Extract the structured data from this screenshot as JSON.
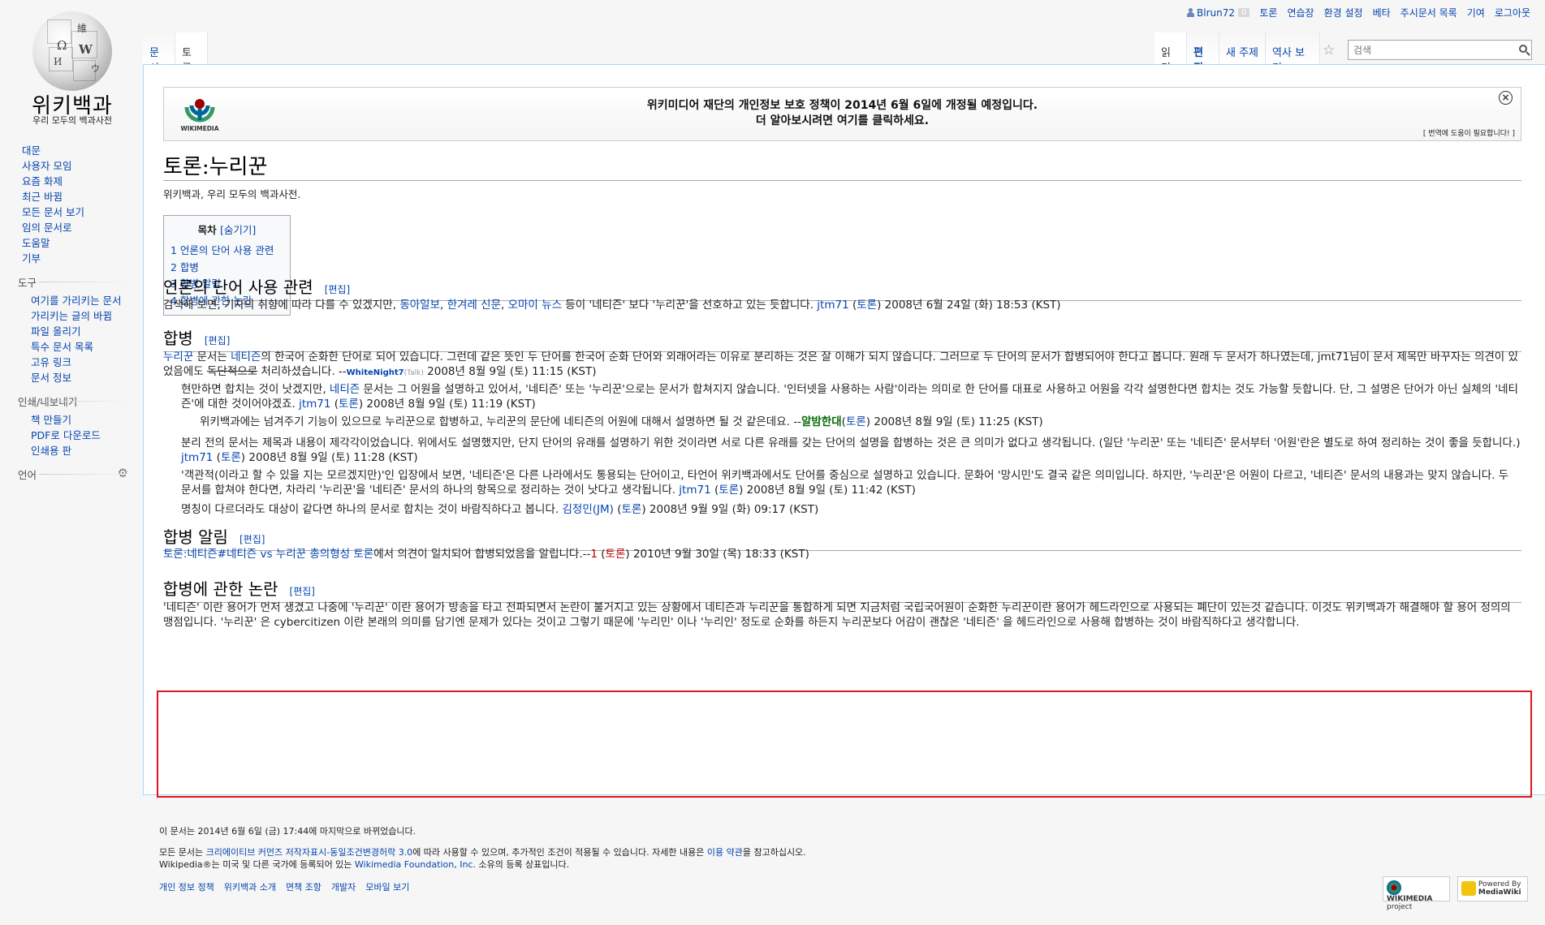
{
  "logo": {
    "title": "위키백과",
    "subtitle": "우리 모두의 백과사전",
    "puzzle": [
      "Ω",
      "W",
      "И",
      "維",
      "ウ"
    ]
  },
  "personal": {
    "username": "Blrun72",
    "notifications": "0",
    "links": [
      "토론",
      "연습장",
      "환경 설정",
      "베타",
      "주시문서 목록",
      "기여",
      "로그아웃"
    ]
  },
  "tabs": {
    "left": [
      "문서",
      "토론"
    ],
    "right": [
      "읽기",
      "편집",
      "새 주제",
      "역사 보기"
    ],
    "search_placeholder": "검색"
  },
  "sidebar": {
    "main": [
      "대문",
      "사용자 모임",
      "요즘 화제",
      "최근 바뀜",
      "모든 문서 보기",
      "임의 문서로",
      "도움말",
      "기부"
    ],
    "tools_heading": "도구",
    "tools": [
      "여기를 가리키는 문서",
      "가리키는 글의 바뀜",
      "파일 올리기",
      "특수 문서 목록",
      "고유 링크",
      "문서 정보"
    ],
    "print_heading": "인쇄/내보내기",
    "print": [
      "책 만들기",
      "PDF로 다운로드",
      "인쇄용 판"
    ],
    "lang_heading": "언어"
  },
  "banner": {
    "logo_text": "WIKIMEDIA",
    "line1": "위키미디어 재단의 개인정보 보호 정책이 2014년 6월 6일에 개정될 예정입니다.",
    "line2": "더 알아보시려면 여기를 클릭하세요.",
    "close": "×",
    "help": "[ 번역에 도움이 필요합니다! ]"
  },
  "page": {
    "title": "토론:누리꾼",
    "tagline": "위키백과, 우리 모두의 백과사전."
  },
  "toc": {
    "title": "목차",
    "toggle": "[숨기기]",
    "items": [
      "1 언론의 단어 사용 관련",
      "2 합병",
      "3 합병 알림",
      "4 합병에 관한 논란"
    ]
  },
  "edit_label": "[편집]",
  "sections": {
    "s1": {
      "heading": "언론의 단어 사용 관련",
      "p1": {
        "a": "검색해 보면, 기자의 취향에 따라 다를 수 있겠지만, ",
        "l1": "동아일보",
        "c1": ", ",
        "l2": "한겨레 신문",
        "c2": ", ",
        "l3": "오마이 뉴스",
        "b": " 등이 '네티즌' 보다 '누리꾼'을 선호하고 있는 듯합니다. ",
        "user": "jtm71",
        "talk": "토론",
        "date": " 2008년 6월 24일 (화) 18:53 (KST)"
      }
    },
    "s2": {
      "heading": "합병",
      "p1": {
        "l1": "누리꾼",
        "a": " 문서는 ",
        "l2": "네티즌",
        "b": "의 한국어 순화한 단어로 되어 있습니다. 그런데 같은 뜻인 두 단어를 한국어 순화 단어와 외래어라는 이유로 분리하는 것은 잘 이해가 되지 않습니다. 그러므로 두 단어의 문서가 합병되어야 한다고 봅니다. 원래 두 문서가 하나였는데, jmt71님이 문서 제목만 바꾸자는 의견이 있었음에도 ",
        "strike": "독단적으로",
        "c": " 처리하셨습니다. --",
        "user": "WhiteNight7",
        "talk": "(Talk)",
        "date": " 2008년 8월 9일 (토) 11:15 (KST)"
      },
      "p2": {
        "a": "현만하면 합치는 것이 낫겠지만, ",
        "l1": "네티즌",
        "b": " 문서는 그 어원을 설명하고 있어서, '네티즌' 또는 '누리꾼'으로는 문서가 합쳐지지 않습니다. '인터넷을 사용하는 사람'이라는 의미로 한 단어를 대표로 사용하고 어원을 각각 설명한다면 합치는 것도 가능할 듯합니다. 단, 그 설명은 단어가 아닌 실체의 '네티즌'에 대한 것이어야겠죠. ",
        "user": "jtm71",
        "talk": "토론",
        "date": " 2008년 8월 9일 (토) 11:19 (KST)"
      },
      "p3": {
        "a": "위키백과에는 넘겨주기 기능이 있으므로 누리꾼으로 합병하고, 누리꾼의 문단에 네티즌의 어원에 대해서 설명하면 될 것 같은데요. --",
        "user": "알밤한대",
        "talk": "토론",
        "date": " 2008년 8월 9일 (토) 11:25 (KST)"
      },
      "p4": {
        "a": "분리 전의 문서는 제목과 내용이 제각각이었습니다. 위에서도 설명했지만, 단지 단어의 유래를 설명하기 위한 것이라면 서로 다른 유래를 갖는 단어의 설명을 합병하는 것은 큰 의미가 없다고 생각됩니다. (일단 '누리꾼' 또는 '네티즌' 문서부터 '어원'란은 별도로 하여 정리하는 것이 좋을 듯합니다.) ",
        "user": "jtm71",
        "talk": "토론",
        "date": " 2008년 8월 9일 (토) 11:28 (KST)"
      },
      "p5": {
        "a": "'객관적(이라고 할 수 있을 지는 모르겠지만)'인 입장에서 보면, '네티즌'은 다른 나라에서도 통용되는 단어이고, 타언어 위키백과에서도 단어를 중심으로 설명하고 있습니다. 문화어 '망시민'도 결국 같은 의미입니다. 하지만, '누리꾼'은 어원이 다르고, '네티즌' 문서의 내용과는 맞지 않습니다. 두 문서를 합쳐야 한다면, 차라리 '누리꾼'을 '네티즌' 문서의 하나의 항목으로 정리하는 것이 낫다고 생각됩니다. ",
        "user": "jtm71",
        "talk": "토론",
        "date": " 2008년 8월 9일 (토) 11:42 (KST)"
      },
      "p6": {
        "a": "명칭이 다르더라도 대상이 같다면 하나의 문서로 합치는 것이 바람직하다고 봅니다. ",
        "user": "김정민(JM)",
        "talk": "토론",
        "date": " 2008년 9월 9일 (화) 09:17 (KST)"
      }
    },
    "s3": {
      "heading": "합병 알림",
      "p1": {
        "l1": "토론:네티즌#네티즌 vs 누리꾼 총의형성 토론",
        "a": "에서 의견이 일치되어 합병되었음을 알립니다.--",
        "user": "1",
        "talk": "토론",
        "date": " 2010년 9월 30일 (목) 18:33 (KST)"
      }
    },
    "s4": {
      "heading": "합병에 관한 논란",
      "p1": "'네티즌' 이란 용어가 먼저 생겼고 나중에 '누리꾼' 이란 용어가 방송을 타고 전파되면서 논란이 불거지고 있는 상황에서 네티즌과 누리꾼을 통합하게 되면 지금처럼 국립국어원이 순화한 누리꾼이란 용어가 헤드라인으로 사용되는 폐단이 있는것 같습니다. 이것도 위키백과가 해결해야 할 용어 정의의 맹점입니다. '누리꾼' 은 cybercitizen 이란 본래의 의미를 담기엔 문제가 있다는 것이고 그렇기 때문에 '누리민' 이나 '누리인' 정도로 순화를 하든지 누리꾼보다 어감이 괜찮은 '네티즌' 을 헤드라인으로 사용해 합병하는 것이 바람직하다고 생각합니다."
    }
  },
  "footer": {
    "lastmod": "이 문서는 2014년 6월 6일 (금) 17:44에 마지막으로 바뀌었습니다.",
    "license_a": "모든 문서는 ",
    "license_link": "크리에이티브 커먼즈 저작자표시-동일조건변경허락 3.0",
    "license_b": "에 따라 사용할 수 있으며, 추가적인 조건이 적용될 수 있습니다. 자세한 내용은 ",
    "terms_link": "이용 약관",
    "license_c": "을 참고하십시오.",
    "tm_a": "Wikipedia®는 미국 및 다른 국가에 등록되어 있는 ",
    "tm_link": "Wikimedia Foundation, Inc.",
    "tm_b": " 소유의 등록 상표입니다.",
    "places": [
      "개인 정보 정책",
      "위키백과 소개",
      "면책 조항",
      "개발자",
      "모바일 보기"
    ],
    "badge1": [
      "WIKIMEDIA",
      "project"
    ],
    "badge2": [
      "Powered By",
      "MediaWiki"
    ]
  },
  "colors": {
    "link": "#0645ad",
    "new_link": "#ba0000",
    "highlight": "#e0151b",
    "content_border": "#a7d7f9"
  }
}
